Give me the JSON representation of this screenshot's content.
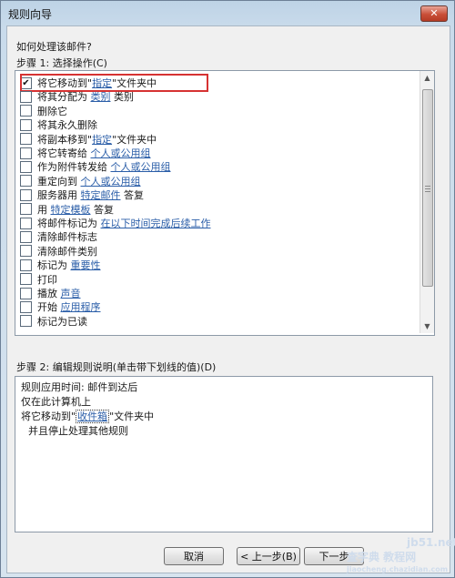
{
  "window": {
    "title": "规则向导",
    "close_glyph": "✕"
  },
  "step1": {
    "question": "如何处理该邮件?",
    "label": "步骤 1: 选择操作(C)",
    "actions": [
      {
        "checked": true,
        "parts": [
          {
            "t": "将它移动到\""
          },
          {
            "t": "指定",
            "link": true
          },
          {
            "t": "\"文件夹中"
          }
        ]
      },
      {
        "checked": false,
        "parts": [
          {
            "t": "将其分配为 "
          },
          {
            "t": "类别",
            "link": true
          },
          {
            "t": " 类别"
          }
        ]
      },
      {
        "checked": false,
        "parts": [
          {
            "t": "删除它"
          }
        ]
      },
      {
        "checked": false,
        "parts": [
          {
            "t": "将其永久删除"
          }
        ]
      },
      {
        "checked": false,
        "parts": [
          {
            "t": "将副本移到\""
          },
          {
            "t": "指定",
            "link": true
          },
          {
            "t": "\"文件夹中"
          }
        ]
      },
      {
        "checked": false,
        "parts": [
          {
            "t": "将它转寄给 "
          },
          {
            "t": "个人或公用组",
            "link": true
          }
        ]
      },
      {
        "checked": false,
        "parts": [
          {
            "t": "作为附件转发给 "
          },
          {
            "t": "个人或公用组",
            "link": true
          }
        ]
      },
      {
        "checked": false,
        "parts": [
          {
            "t": "重定向到 "
          },
          {
            "t": "个人或公用组",
            "link": true
          }
        ]
      },
      {
        "checked": false,
        "parts": [
          {
            "t": "服务器用 "
          },
          {
            "t": "特定邮件",
            "link": true
          },
          {
            "t": " 答复"
          }
        ]
      },
      {
        "checked": false,
        "parts": [
          {
            "t": "用 "
          },
          {
            "t": "特定模板",
            "link": true
          },
          {
            "t": " 答复"
          }
        ]
      },
      {
        "checked": false,
        "parts": [
          {
            "t": "将邮件标记为 "
          },
          {
            "t": "在以下时间完成后续工作",
            "link": true
          }
        ]
      },
      {
        "checked": false,
        "parts": [
          {
            "t": "清除邮件标志"
          }
        ]
      },
      {
        "checked": false,
        "parts": [
          {
            "t": "清除邮件类别"
          }
        ]
      },
      {
        "checked": false,
        "parts": [
          {
            "t": "标记为 "
          },
          {
            "t": "重要性",
            "link": true
          }
        ]
      },
      {
        "checked": false,
        "parts": [
          {
            "t": "打印"
          }
        ]
      },
      {
        "checked": false,
        "parts": [
          {
            "t": "播放 "
          },
          {
            "t": "声音",
            "link": true
          }
        ]
      },
      {
        "checked": false,
        "parts": [
          {
            "t": "开始 "
          },
          {
            "t": "应用程序",
            "link": true
          }
        ]
      },
      {
        "checked": false,
        "parts": [
          {
            "t": "标记为已读"
          }
        ]
      }
    ]
  },
  "step2": {
    "label": "步骤 2: 编辑规则说明(单击带下划线的值)(D)",
    "line1": "规则应用时间: 邮件到达后",
    "line2": "仅在此计算机上",
    "line3_pre": "将它移动到\"",
    "line3_link": "收件箱",
    "line3_post": "\"文件夹中",
    "line4": "并且停止处理其他规则"
  },
  "buttons": {
    "cancel": "取消",
    "back": "< 上一步(B)",
    "next": "下一步"
  },
  "watermark": {
    "text1": "jb51.net",
    "text2": "查字典 教程网",
    "text3": "jiaocheng.chazidian.com"
  }
}
